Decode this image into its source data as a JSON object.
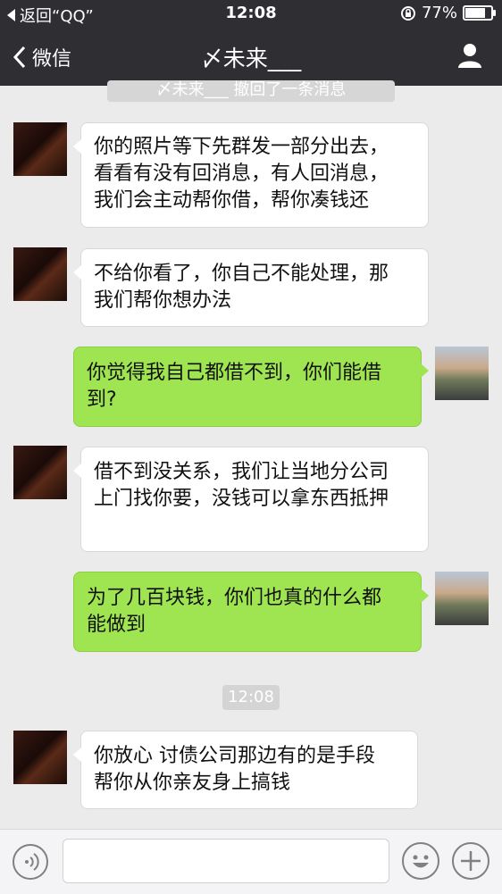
{
  "status": {
    "back_text": "返回“QQ”",
    "time": "12:08",
    "battery": "77%",
    "battery_level": 0.77
  },
  "nav": {
    "back_label": "微信",
    "title": "〆未来___"
  },
  "recall_notice": "〆未来___ 撤回了一条消息",
  "messages": [
    {
      "side": "in",
      "lines": [
        "你的照片等下先群发一部分出去，",
        "看看有没有回消息，有人回消息，",
        "我们会主动帮你借，帮你凑钱还"
      ]
    },
    {
      "side": "in",
      "lines": [
        "不给你看了，你自己不能处理，那",
        "我们帮你想办法"
      ]
    },
    {
      "side": "out",
      "lines": [
        "你觉得我自己都借不到，你们能借",
        "到?"
      ]
    },
    {
      "side": "in",
      "lines": [
        "借不到没关系，我们让当地分公司",
        "上门找你要，没钱可以拿东西抵押"
      ]
    },
    {
      "side": "out",
      "lines": [
        "为了几百块钱，你们也真的什么都",
        "能做到"
      ]
    },
    {
      "side": "in",
      "lines": [
        "你放心 讨债公司那边有的是手段",
        "帮你从你亲友身上搞钱"
      ]
    }
  ],
  "time_divider": "12:08",
  "colors": {
    "nav_bg": "#2e2e33",
    "chat_bg": "#ebebeb",
    "out_bubble": "#9fe551",
    "in_bubble": "#ffffff"
  }
}
